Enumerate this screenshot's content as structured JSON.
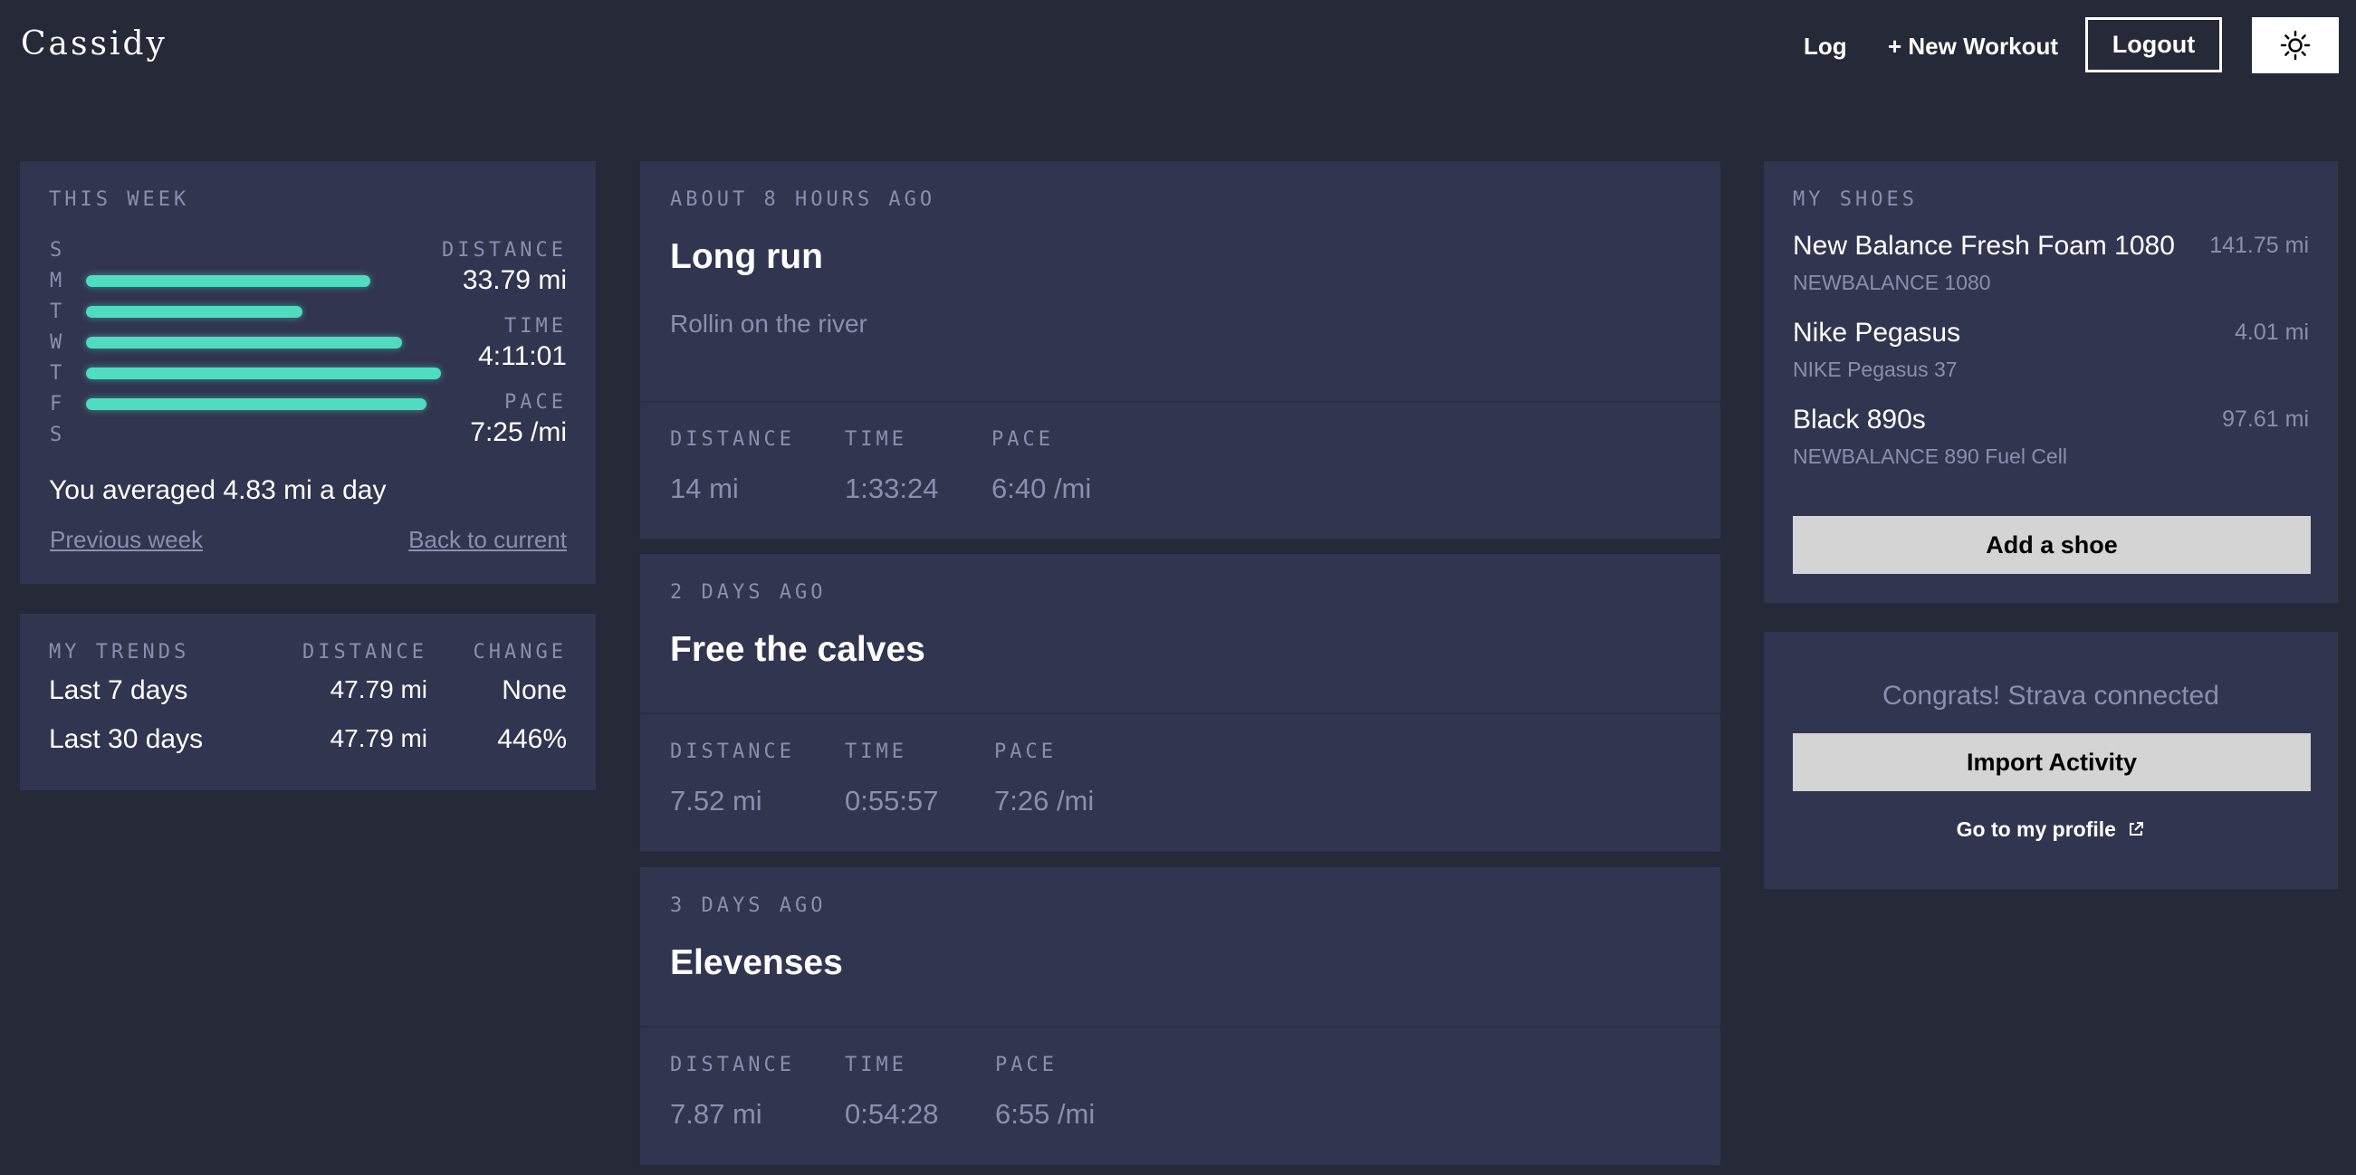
{
  "header": {
    "logo": "Cassidy",
    "log_label": "Log",
    "new_workout_label": "+ New Workout",
    "logout_label": "Logout",
    "theme_icon": "sun-icon"
  },
  "this_week": {
    "title": "THIS WEEK",
    "days": [
      {
        "letter": "S",
        "fraction": 0
      },
      {
        "letter": "M",
        "fraction": 0.8
      },
      {
        "letter": "T",
        "fraction": 0.61
      },
      {
        "letter": "W",
        "fraction": 0.89
      },
      {
        "letter": "T",
        "fraction": 1.0
      },
      {
        "letter": "F",
        "fraction": 0.96
      },
      {
        "letter": "S",
        "fraction": 0
      }
    ],
    "distance_label": "DISTANCE",
    "distance": "33.79 mi",
    "time_label": "TIME",
    "time": "4:11:01",
    "pace_label": "PACE",
    "pace": "7:25 /mi",
    "average": "You averaged 4.83 mi a day",
    "previous_week": "Previous week",
    "back_to_current": "Back to current"
  },
  "trends": {
    "title": "MY TRENDS",
    "distance_label": "DISTANCE",
    "change_label": "CHANGE",
    "rows": [
      {
        "name": "Last 7 days",
        "distance": "47.79 mi",
        "change": "None"
      },
      {
        "name": "Last 30 days",
        "distance": "47.79 mi",
        "change": "446%"
      }
    ]
  },
  "workouts": [
    {
      "ago": "ABOUT 8 HOURS AGO",
      "title": "Long run",
      "description": "Rollin on the river",
      "distance_label": "DISTANCE",
      "time_label": "TIME",
      "pace_label": "PACE",
      "distance": "14 mi",
      "time": "1:33:24",
      "pace": "6:40 /mi"
    },
    {
      "ago": "2 DAYS AGO",
      "title": "Free the calves",
      "description": "",
      "distance_label": "DISTANCE",
      "time_label": "TIME",
      "pace_label": "PACE",
      "distance": "7.52 mi",
      "time": "0:55:57",
      "pace": "7:26 /mi"
    },
    {
      "ago": "3 DAYS AGO",
      "title": "Elevenses",
      "description": "",
      "distance_label": "DISTANCE",
      "time_label": "TIME",
      "pace_label": "PACE",
      "distance": "7.87 mi",
      "time": "0:54:28",
      "pace": "6:55 /mi"
    }
  ],
  "shoes": {
    "title": "MY SHOES",
    "items": [
      {
        "name": "New Balance Fresh Foam 1080",
        "model": "NEWBALANCE 1080",
        "miles": "141.75 mi"
      },
      {
        "name": "Nike Pegasus",
        "model": "NIKE Pegasus 37",
        "miles": "4.01 mi"
      },
      {
        "name": "Black 890s",
        "model": "NEWBALANCE 890 Fuel Cell",
        "miles": "97.61 mi"
      }
    ],
    "add_label": "Add a shoe"
  },
  "strava": {
    "message": "Congrats! Strava connected",
    "import_label": "Import Activity",
    "profile_label": "Go to my profile",
    "profile_icon": "external-link-icon"
  },
  "colors": {
    "background": "#252938",
    "panel": "#31354f",
    "accent": "#4fdcc0",
    "muted": "#8a8fae"
  }
}
